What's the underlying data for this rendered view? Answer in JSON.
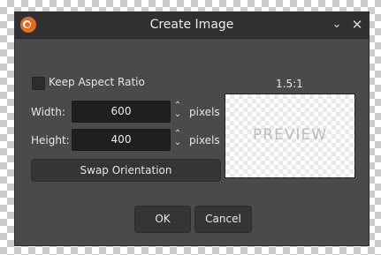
{
  "window": {
    "title": "Create Image",
    "minimize_icon": "chevron-down-icon",
    "close_icon": "close-icon"
  },
  "form": {
    "keep_aspect_label": "Keep Aspect Ratio",
    "keep_aspect_checked": false,
    "width_label": "Width:",
    "width_value": "600",
    "height_label": "Height:",
    "height_value": "400",
    "unit": "pixels",
    "swap_label": "Swap Orientation"
  },
  "preview": {
    "ratio": "1.5:1",
    "placeholder": "PREVIEW"
  },
  "buttons": {
    "ok": "OK",
    "cancel": "Cancel"
  },
  "colors": {
    "dialog_bg": "#4a4a4a",
    "titlebar_bg": "#303030",
    "input_bg": "#1f1f1f",
    "app_icon": "#e06b26"
  }
}
